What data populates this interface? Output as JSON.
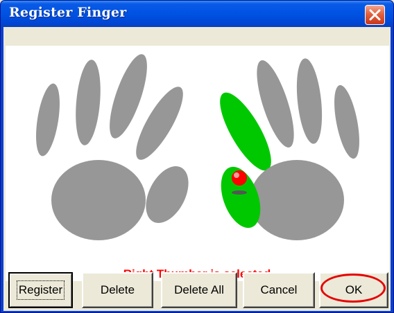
{
  "window": {
    "title": "Register Finger"
  },
  "status": {
    "text": "Right Thumber is selected",
    "color": "#ff0000"
  },
  "hands": {
    "left": {
      "fingers": [
        "pinky",
        "ring",
        "middle",
        "index",
        "thumb"
      ],
      "state": "unregistered"
    },
    "right": {
      "fingers": [
        "thumb",
        "index",
        "middle",
        "ring",
        "pinky"
      ],
      "registered": [
        "thumb",
        "index"
      ],
      "selected": "thumb"
    }
  },
  "buttons": {
    "register": "Register",
    "delete": "Delete",
    "delete_all": "Delete All",
    "cancel": "Cancel",
    "ok": "OK"
  },
  "colors": {
    "hand": "#979797",
    "registered": "#00c800",
    "marker": "#ff0000",
    "title_bar": "#0054e3",
    "close": "#e1623f"
  },
  "icons": {
    "close": "close-icon",
    "marker": "red-marker-icon"
  }
}
